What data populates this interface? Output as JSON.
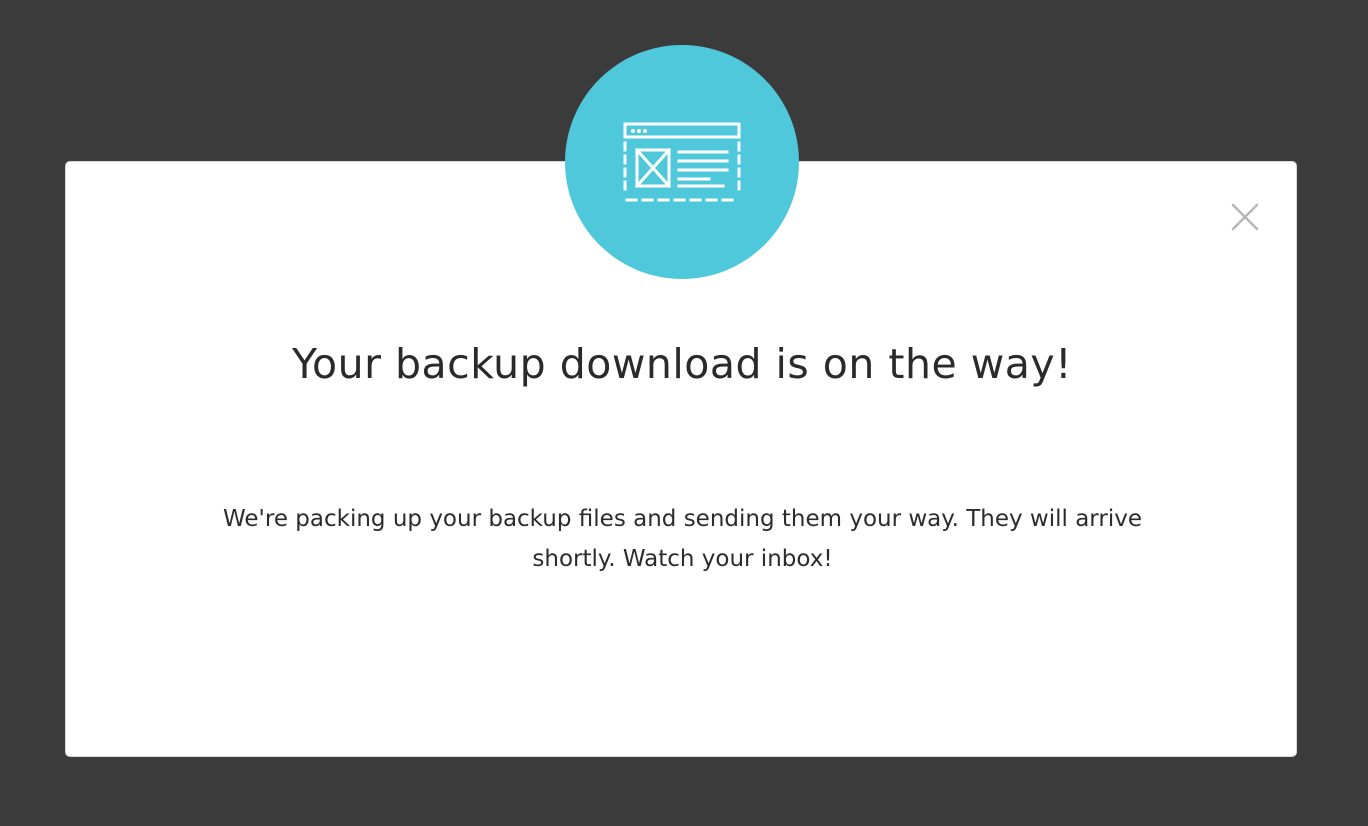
{
  "colors": {
    "backdrop": "#3b3b3b",
    "accent": "#50c8dc",
    "modal_background": "#ffffff",
    "title_text": "#2a2a2a",
    "close_icon": "#b5b5b5"
  },
  "modal": {
    "icon": "browser-wireframe-icon",
    "close_icon": "close-icon",
    "title": "Your backup download is on the way!",
    "message": "We're packing up your backup files and sending them your way. They will arrive shortly. Watch your inbox!"
  }
}
